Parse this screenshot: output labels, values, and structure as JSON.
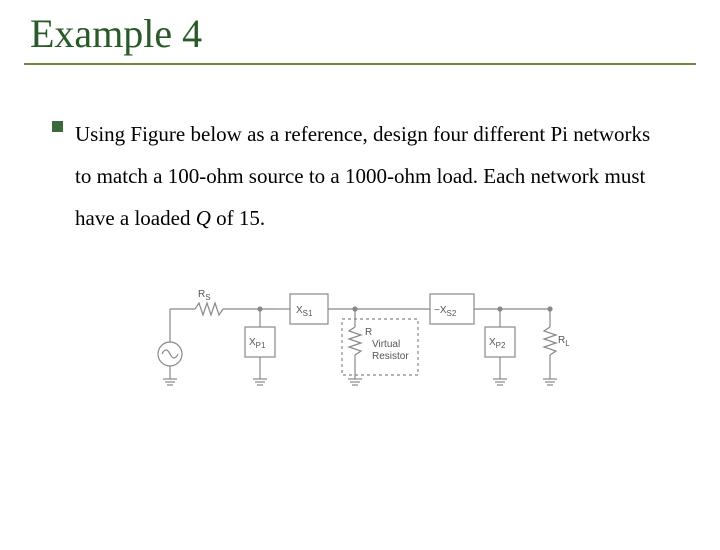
{
  "slide": {
    "title": "Example 4",
    "bullet_text": "Using Figure below as a reference, design four different Pi networks to match a 100-ohm source to a 1000-ohm load. Each network must have a loaded Q of 15.",
    "italic_var": "Q"
  },
  "circuit": {
    "labels": {
      "Rs": "R",
      "Rs_sub": "S",
      "Xp1": "X",
      "Xp1_sub": "P1",
      "Xs1": "X",
      "Xs1_sub": "S1",
      "Xs2_prefix": "−X",
      "Xs2_sub": "S2",
      "R": "R",
      "virtual": "Virtual",
      "resistor": "Resistor",
      "Xp2": "X",
      "Xp2_sub": "P2",
      "Rl": "R",
      "Rl_sub": "L"
    }
  }
}
